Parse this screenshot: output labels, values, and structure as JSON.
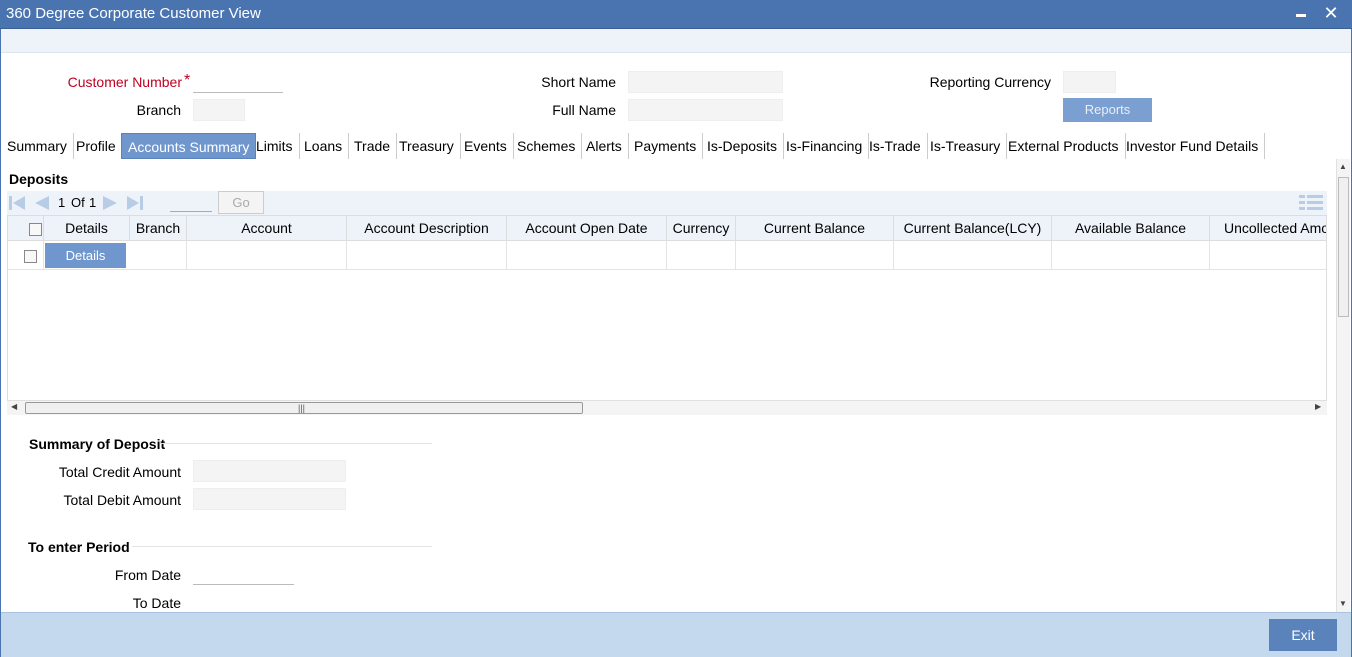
{
  "window": {
    "title": "360 Degree Corporate Customer View",
    "minimize_icon": "minimize-icon",
    "close_icon": "close-icon",
    "close_glyph": "✕"
  },
  "header": {
    "customer_number_label": "Customer Number",
    "required_marker": "*",
    "customer_number_value": "",
    "branch_label": "Branch",
    "branch_value": "",
    "short_name_label": "Short Name",
    "short_name_value": "",
    "full_name_label": "Full Name",
    "full_name_value": "",
    "reporting_currency_label": "Reporting Currency",
    "reporting_currency_value": "",
    "reports_button": "Reports"
  },
  "tabs": [
    {
      "label": "Summary",
      "active": false
    },
    {
      "label": "Profile",
      "active": false
    },
    {
      "label": "Accounts Summary",
      "active": true
    },
    {
      "label": "Limits",
      "active": false
    },
    {
      "label": "Loans",
      "active": false
    },
    {
      "label": "Trade",
      "active": false
    },
    {
      "label": "Treasury",
      "active": false
    },
    {
      "label": "Events",
      "active": false
    },
    {
      "label": "Schemes",
      "active": false
    },
    {
      "label": "Alerts",
      "active": false
    },
    {
      "label": "Payments",
      "active": false
    },
    {
      "label": "Is-Deposits",
      "active": false
    },
    {
      "label": "Is-Financing",
      "active": false
    },
    {
      "label": "Is-Trade",
      "active": false
    },
    {
      "label": "Is-Treasury",
      "active": false
    },
    {
      "label": "External Products",
      "active": false
    },
    {
      "label": "Investor Fund Details",
      "active": false
    }
  ],
  "deposits": {
    "title": "Deposits",
    "pager": {
      "current": "1",
      "of_label": "Of",
      "total": "1",
      "go_button": "Go"
    },
    "columns": [
      "Details",
      "Branch",
      "Account",
      "Account Description",
      "Account Open Date",
      "Currency",
      "Current Balance",
      "Current Balance(LCY)",
      "Available Balance",
      "Uncollected Amou"
    ],
    "row_details_button": "Details"
  },
  "summary_of_deposit": {
    "title": "Summary of Deposit",
    "total_credit_label": "Total Credit Amount",
    "total_credit_value": "",
    "total_debit_label": "Total Debit Amount",
    "total_debit_value": ""
  },
  "period": {
    "title": "To enter Period",
    "from_date_label": "From Date",
    "from_date_value": "",
    "to_date_label": "To Date"
  },
  "footer": {
    "exit_button": "Exit"
  },
  "colors": {
    "title_bar": "#4a74b0",
    "active_tab": "#6f97cd",
    "footer": "#c4d8ee",
    "required": "#c00020"
  }
}
